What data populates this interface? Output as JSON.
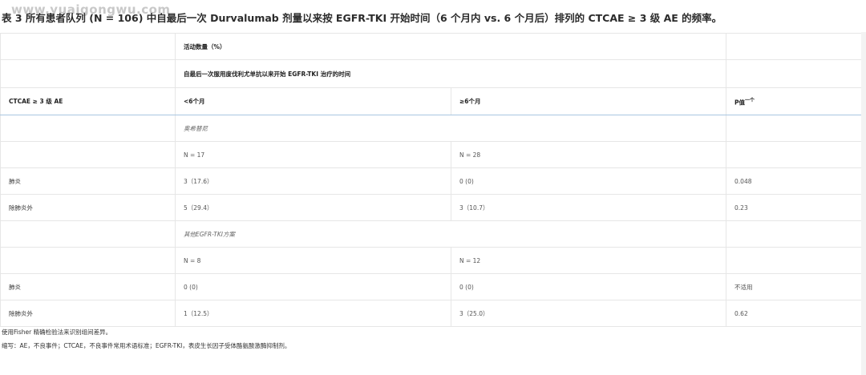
{
  "watermark": "www.yuaigongwu.com",
  "title": "表 3  所有患者队列 (N = 106) 中自最后一次 Durvalumab 剂量以来按 EGFR-TKI 开始时间（6 个月内 vs. 6 个月后）排列的 CTCAE ≥ 3 级 AE 的频率。",
  "table": {
    "header1": "活动数量（%）",
    "header2": "自最后一次服用度伐利尤单抗以来开始 EGFR-TKI 治疗的时间",
    "col_ctcae": "CTCAE ≥ 3 级 AE",
    "col_lt6": "<6个月",
    "col_ge6": "≥6个月",
    "col_p": "P值",
    "col_p_sup": "一个",
    "sections": [
      {
        "name": "奥希替尼",
        "n_lt6": "N = 17",
        "n_ge6": "N = 28",
        "rows": [
          {
            "label": "肺炎",
            "lt6": "3（17.6）",
            "ge6": "0 (0)",
            "p": "0.048"
          },
          {
            "label": "除肺炎外",
            "lt6": "5（29.4）",
            "ge6": "3（10.7）",
            "p": "0.23"
          }
        ]
      },
      {
        "name": "其他EGFR-TKI方案",
        "n_lt6": "N = 8",
        "n_ge6": "N = 12",
        "rows": [
          {
            "label": "肺炎",
            "lt6": "0 (0)",
            "ge6": "0 (0)",
            "p": "不适用"
          },
          {
            "label": "除肺炎外",
            "lt6": "1（12.5）",
            "ge6": "3（25.0）",
            "p": "0.62"
          }
        ]
      }
    ]
  },
  "footnote1": "使用Fisher 精确检验法来识别组间差异。",
  "footnote2": "缩写：AE，不良事件；CTCAE，不良事件常用术语标准；EGFR-TKI，表皮生长因子受体酪氨酸激酶抑制剂。"
}
